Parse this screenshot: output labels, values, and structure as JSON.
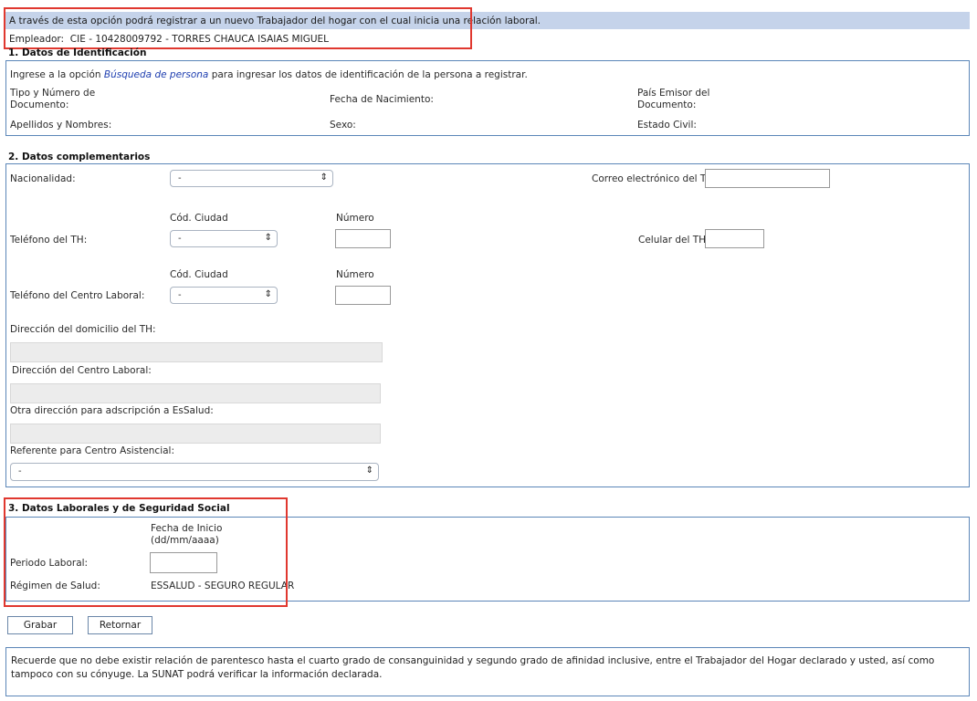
{
  "header": {
    "info_text": "A través de esta opción podrá registrar a un nuevo Trabajador del hogar con el cual inicia una relación laboral.",
    "employer_label": "Empleador:",
    "employer_value": "CIE - 10428009792 - TORRES CHAUCA ISAIAS MIGUEL"
  },
  "section1": {
    "title": "1. Datos de Identificación",
    "hint_prefix": "Ingrese a la opción",
    "hint_link": "Búsqueda de persona",
    "hint_suffix": "para ingresar los datos de identificación de la persona a registrar.",
    "doc_type_line1": "Tipo y Número de",
    "doc_type_line2": "Documento:",
    "birth_date": "Fecha de Nacimiento:",
    "issuer_line1": "País Emisor del",
    "issuer_line2": "Documento:",
    "names": "Apellidos y Nombres:",
    "sex": "Sexo:",
    "civil_status": "Estado Civil:"
  },
  "section2": {
    "title": "2. Datos complementarios",
    "nationality_label": "Nacionalidad:",
    "nationality_value": "-",
    "email_label": "Correo electrónico del TH:",
    "city_code_label": "Cód. Ciudad",
    "number_label": "Número",
    "phone_label": "Teléfono del TH:",
    "phone_city_value": "-",
    "mobile_label": "Celular del TH:",
    "work_phone_label": "Teléfono del Centro Laboral:",
    "work_phone_city_value": "-",
    "home_address_label": "Dirección del domicilio del TH:",
    "work_address_label": "Dirección del Centro Laboral:",
    "essalud_address_label": "Otra dirección para adscripción a EsSalud:",
    "care_center_label": "Referente para Centro Asistencial:",
    "care_center_value": "-"
  },
  "section3": {
    "title": "3. Datos Laborales y de Seguridad Social",
    "start_date_line1": "Fecha de Inicio",
    "start_date_line2": "(dd/mm/aaaa)",
    "period_label": "Periodo Laboral:",
    "health_regime_label": "Régimen de Salud:",
    "health_regime_value": "ESSALUD - SEGURO REGULAR"
  },
  "buttons": {
    "save": "Grabar",
    "back": "Retornar"
  },
  "notice": {
    "text": "Recuerde que no debe existir relación de parentesco hasta el cuarto grado de consanguinidad y segundo grado de afinidad inclusive, entre el Trabajador del Hogar declarado y usted, así como tampoco con su cónyuge. La SUNAT podrá verificar la información declarada."
  },
  "colors": {
    "info_bar": "#c5d3ea",
    "panel_border": "#5b86b8",
    "highlight": "#e0382f",
    "link": "#1f3fb0"
  }
}
